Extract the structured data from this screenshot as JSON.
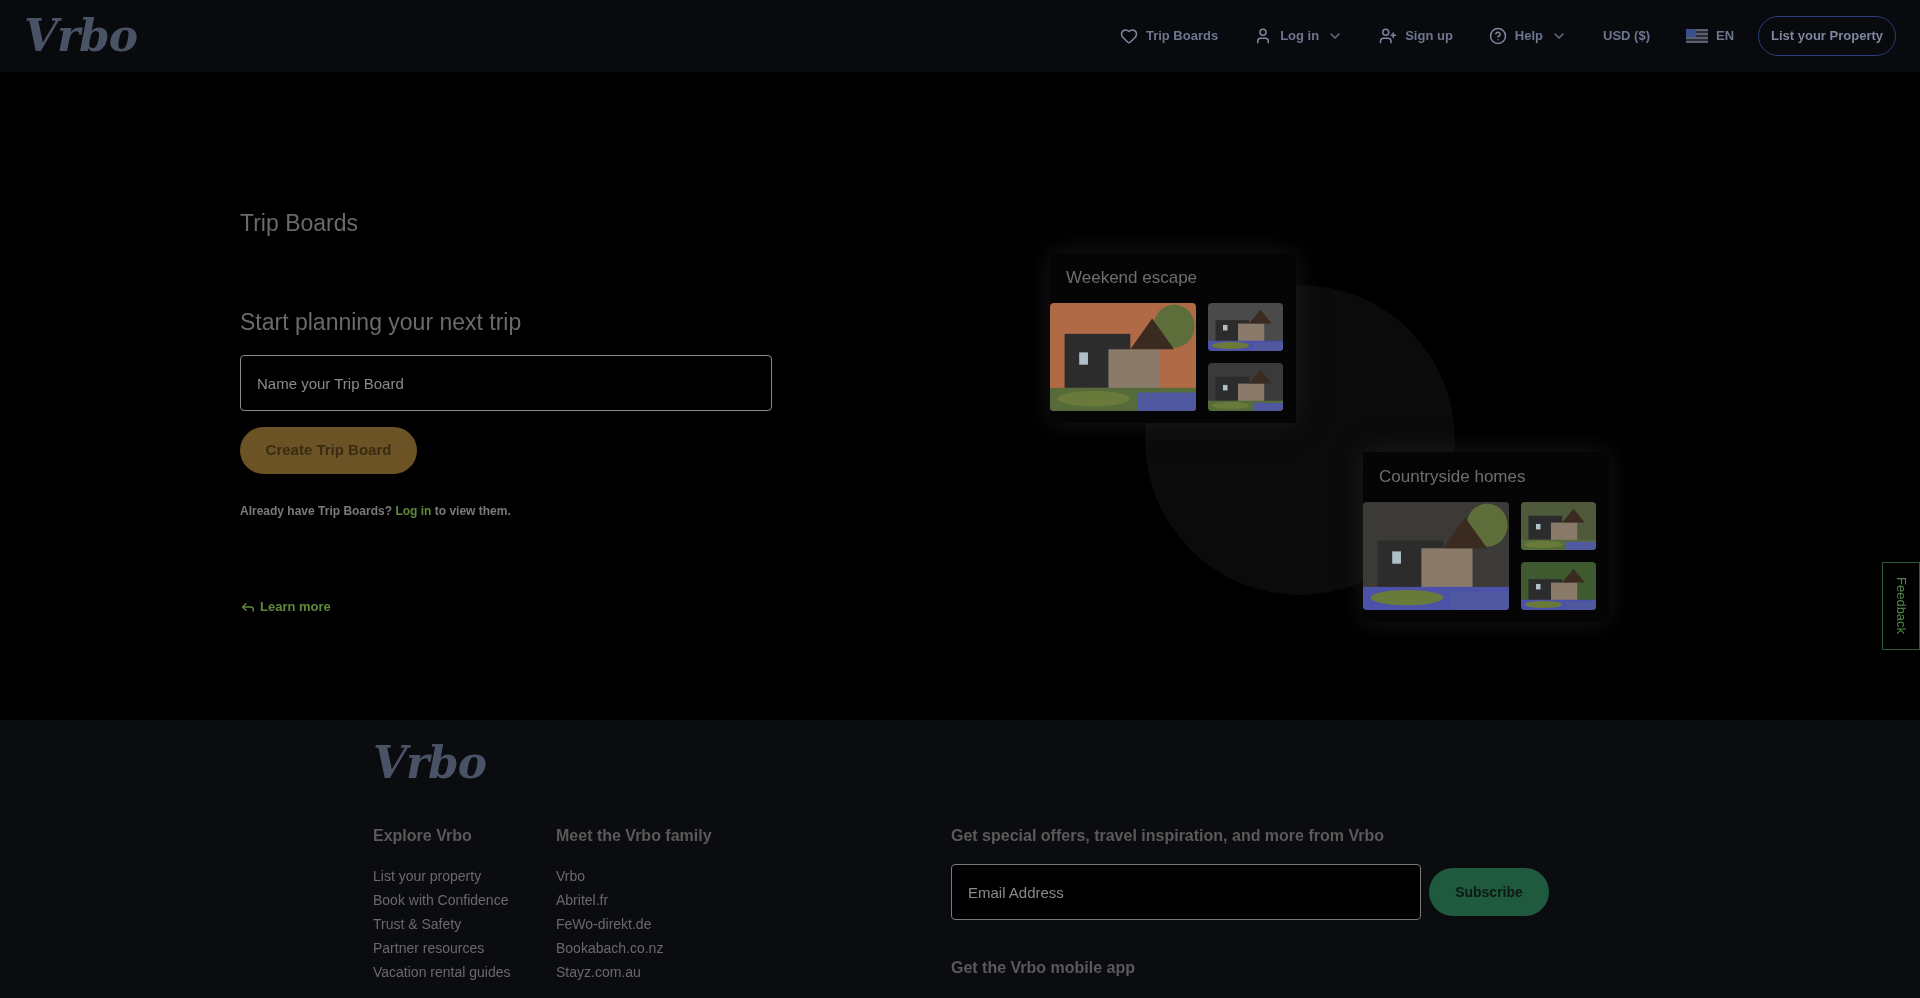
{
  "header": {
    "logo": "Vrbo",
    "nav": [
      {
        "kind": "heart",
        "label": "Trip Boards",
        "dropdown": false
      },
      {
        "kind": "user",
        "label": "Log in",
        "dropdown": true
      },
      {
        "kind": "user-plus",
        "label": "Sign up",
        "dropdown": false
      },
      {
        "kind": "help",
        "label": "Help",
        "dropdown": true
      },
      {
        "kind": "text",
        "label": "USD ($)",
        "dropdown": false
      },
      {
        "kind": "flag",
        "label": "EN",
        "dropdown": false
      }
    ],
    "cta": "List your Property"
  },
  "main": {
    "title": "Trip Boards",
    "subtitle": "Start planning your next trip",
    "input": {
      "placeholder": "Name your Trip Board"
    },
    "create_button": "Create Trip Board",
    "login_prompt": {
      "before": "Already have Trip Boards?",
      "link": "Log in",
      "after": "to view them."
    },
    "learn_more": "Learn more",
    "boards": [
      {
        "title": "Weekend escape",
        "kind": "picture"
      },
      {
        "title": "Countryside homes",
        "kind": "picture"
      }
    ]
  },
  "feedback": "Feedback",
  "footer": {
    "logo": "Vrbo",
    "columns": [
      {
        "heading": "Explore Vrbo",
        "links": [
          "List your property",
          "Book with Confidence",
          "Trust & Safety",
          "Partner resources",
          "Vacation rental guides"
        ]
      },
      {
        "heading": "Meet the Vrbo family",
        "links": [
          "Vrbo",
          "Abritel.fr",
          "FeWo-direkt.de",
          "Bookabach.co.nz",
          "Stayz.com.au"
        ]
      }
    ],
    "newsletter": {
      "heading": "Get special offers, travel inspiration, and more from Vrbo",
      "input": {
        "placeholder": "Email Address"
      },
      "button": "Subscribe"
    },
    "app_heading": "Get the Vrbo mobile app"
  }
}
